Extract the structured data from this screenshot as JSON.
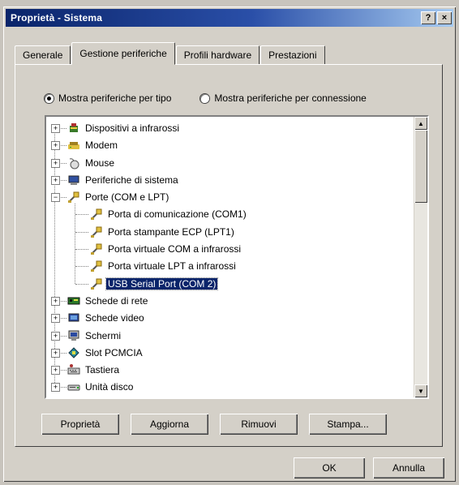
{
  "window": {
    "title": "Proprietà - Sistema"
  },
  "titlebar_buttons": {
    "help": "?",
    "close": "×"
  },
  "tabs": [
    {
      "label": "Generale",
      "active": false
    },
    {
      "label": "Gestione periferiche",
      "active": true
    },
    {
      "label": "Profili hardware",
      "active": false
    },
    {
      "label": "Prestazioni",
      "active": false
    }
  ],
  "view_options": {
    "by_type": {
      "label": "Mostra periferiche per tipo",
      "selected": true
    },
    "by_connection": {
      "label": "Mostra periferiche per connessione",
      "selected": false
    }
  },
  "tree": [
    {
      "label": "Dispositivi a infrarossi",
      "level": 0,
      "expander": "+",
      "icon": "infrared-icon"
    },
    {
      "label": "Modem",
      "level": 0,
      "expander": "+",
      "icon": "modem-icon"
    },
    {
      "label": "Mouse",
      "level": 0,
      "expander": "+",
      "icon": "mouse-icon"
    },
    {
      "label": "Periferiche di sistema",
      "level": 0,
      "expander": "+",
      "icon": "system-devices-icon"
    },
    {
      "label": "Porte (COM e LPT)",
      "level": 0,
      "expander": "−",
      "icon": "port-icon"
    },
    {
      "label": "Porta di comunicazione (COM1)",
      "level": 1,
      "icon": "port-icon"
    },
    {
      "label": "Porta stampante ECP (LPT1)",
      "level": 1,
      "icon": "port-icon"
    },
    {
      "label": "Porta virtuale COM a infrarossi",
      "level": 1,
      "icon": "port-icon"
    },
    {
      "label": "Porta virtuale LPT a infrarossi",
      "level": 1,
      "icon": "port-icon"
    },
    {
      "label": "USB Serial Port (COM 2)",
      "level": 1,
      "icon": "port-icon",
      "selected": true
    },
    {
      "label": "Schede di rete",
      "level": 0,
      "expander": "+",
      "icon": "network-card-icon"
    },
    {
      "label": "Schede video",
      "level": 0,
      "expander": "+",
      "icon": "display-adapter-icon"
    },
    {
      "label": "Schermi",
      "level": 0,
      "expander": "+",
      "icon": "monitor-icon"
    },
    {
      "label": "Slot PCMCIA",
      "level": 0,
      "expander": "+",
      "icon": "pcmcia-icon"
    },
    {
      "label": "Tastiera",
      "level": 0,
      "expander": "+",
      "icon": "keyboard-icon"
    },
    {
      "label": "Unità disco",
      "level": 0,
      "expander": "+",
      "icon": "disk-drive-icon"
    }
  ],
  "scrollbar": {
    "up": "▲",
    "down": "▼"
  },
  "actions": {
    "properties": "Proprietà",
    "refresh": "Aggiorna",
    "remove": "Rimuovi",
    "print": "Stampa..."
  },
  "footer": {
    "ok": "OK",
    "cancel": "Annulla"
  },
  "colors": {
    "title_bar": "#0a246a",
    "selection": "#0a246a",
    "face": "#d4d0c8"
  }
}
